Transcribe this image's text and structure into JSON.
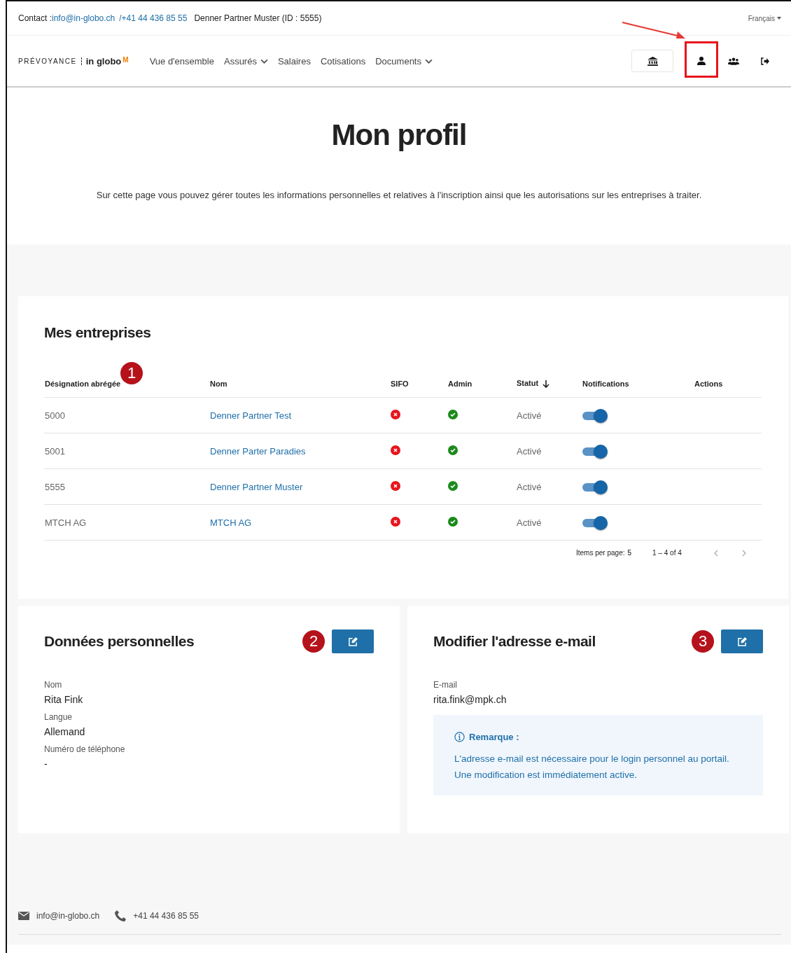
{
  "topbar": {
    "contact_label": "Contact :",
    "email": "info@in-globo.ch",
    "separator": "/",
    "phone": "+41 44 436 85 55",
    "partner": "Denner Partner Muster (ID : 5555)",
    "language": "Français"
  },
  "nav": {
    "logo_left": "PRÉVOYANCE",
    "logo_right": "in globo",
    "logo_mark": "M",
    "items": [
      {
        "label": "Vue d'ensemble",
        "dropdown": false
      },
      {
        "label": "Assurés",
        "dropdown": true
      },
      {
        "label": "Salaires",
        "dropdown": false
      },
      {
        "label": "Cotisations",
        "dropdown": false
      },
      {
        "label": "Documents",
        "dropdown": true
      }
    ],
    "icons": [
      {
        "kind": "bank",
        "selected": false
      },
      {
        "kind": "user",
        "selected": true
      },
      {
        "kind": "users",
        "selected": false
      },
      {
        "kind": "logout",
        "selected": false
      }
    ]
  },
  "hero": {
    "title": "Mon profil",
    "text": "Sur cette page vous pouvez gérer toutes les informations personnelles et relatives à l'inscription ainsi que les autorisations sur les entreprises à traiter."
  },
  "companies": {
    "title": "Mes entreprises",
    "marker": "1",
    "columns": [
      "Désignation abrégée",
      "Nom",
      "SIFO",
      "Admin",
      "Statut",
      "Notifications",
      "Actions"
    ],
    "rows": [
      {
        "code": "5000",
        "name": "Denner Partner Test",
        "sifo": false,
        "admin": true,
        "status": "Activé",
        "notifications": true
      },
      {
        "code": "5001",
        "name": "Denner Parter Paradies",
        "sifo": false,
        "admin": true,
        "status": "Activé",
        "notifications": true
      },
      {
        "code": "5555",
        "name": "Denner Partner Muster",
        "sifo": false,
        "admin": true,
        "status": "Activé",
        "notifications": true
      },
      {
        "code": "MTCH AG",
        "name": "MTCH AG",
        "sifo": false,
        "admin": true,
        "status": "Activé",
        "notifications": true
      }
    ],
    "paginator": {
      "label": "Items per page:",
      "size": "5",
      "range": "1 – 4 of 4"
    }
  },
  "personal": {
    "title": "Données personnelles",
    "marker": "2",
    "fields": [
      {
        "label": "Nom",
        "value": "Rita Fink"
      },
      {
        "label": "Langue",
        "value": "Allemand"
      },
      {
        "label": "Numéro de téléphone",
        "value": "-"
      }
    ]
  },
  "email_card": {
    "title": "Modifier l'adresse e-mail",
    "marker": "3",
    "fields": [
      {
        "label": "E-mail",
        "value": "rita.fink@mpk.ch"
      }
    ],
    "note_title": "Remarque :",
    "note": "L'adresse e-mail est nécessaire pour le login personnel au portail. Une modification est immédiatement active."
  },
  "footer": {
    "email": "info@in-globo.ch",
    "phone": "+41 44 436 85 55"
  }
}
